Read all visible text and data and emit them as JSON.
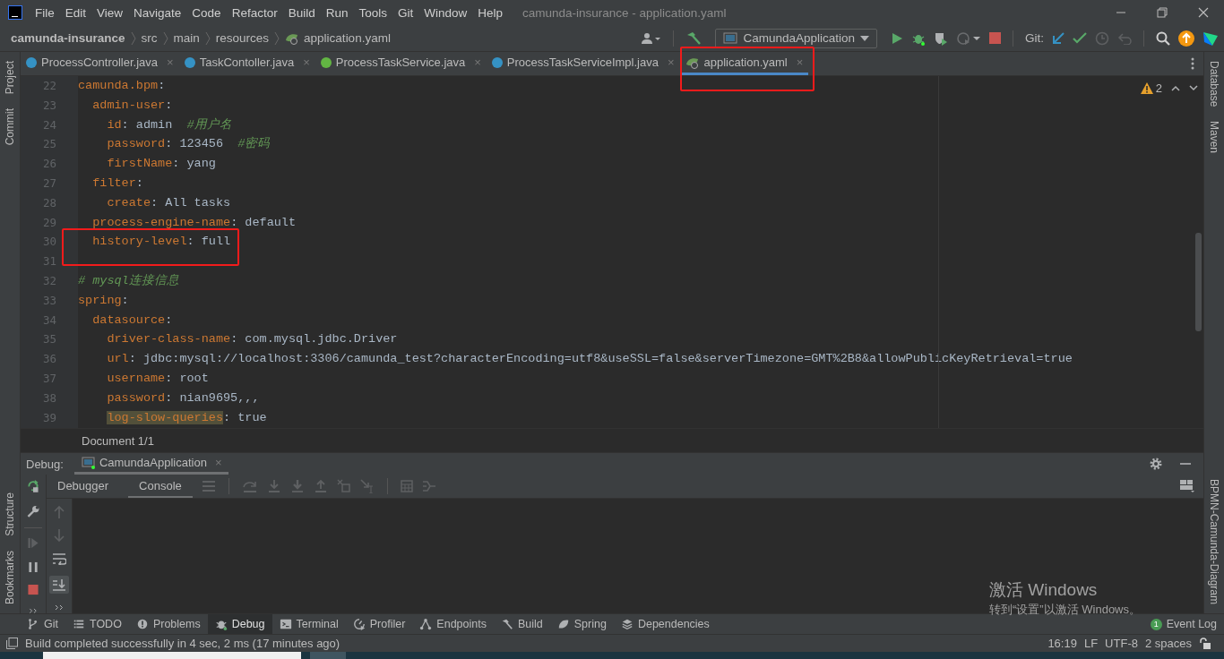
{
  "window": {
    "title": "camunda-insurance - application.yaml"
  },
  "menu": [
    "File",
    "Edit",
    "View",
    "Navigate",
    "Code",
    "Refactor",
    "Build",
    "Run",
    "Tools",
    "Git",
    "Window",
    "Help"
  ],
  "breadcrumbs": [
    {
      "label": "camunda-insurance",
      "kind": "project"
    },
    {
      "label": "src",
      "kind": "folder"
    },
    {
      "label": "main",
      "kind": "folder"
    },
    {
      "label": "resources",
      "kind": "folder"
    },
    {
      "label": "application.yaml",
      "kind": "yaml"
    }
  ],
  "run_config": {
    "label": "CamundaApplication"
  },
  "vcs_label": "Git:",
  "left_panels_top": [
    "Project",
    "Commit"
  ],
  "left_panels_bottom": [
    "Structure",
    "Bookmarks"
  ],
  "right_panels_top": [
    "Database",
    "Maven"
  ],
  "right_panels_bottom": [
    "BPMN-Camunda-Diagram"
  ],
  "tabs": [
    {
      "label": "ProcessController.java",
      "kind": "class",
      "close": "×",
      "selected": false
    },
    {
      "label": "TaskContoller.java",
      "kind": "class",
      "close": "×",
      "selected": false
    },
    {
      "label": "ProcessTaskService.java",
      "kind": "interface",
      "close": "×",
      "selected": false
    },
    {
      "label": "ProcessTaskServiceImpl.java",
      "kind": "class",
      "close": "×",
      "selected": false
    },
    {
      "label": "application.yaml",
      "kind": "yaml",
      "close": "×",
      "selected": true
    }
  ],
  "editor": {
    "warnings": "2",
    "breadcrumb": "Document 1/1",
    "lines": [
      {
        "number": "22",
        "tokens": [
          {
            "kind": "key",
            "text": "camunda.bpm"
          },
          {
            "kind": "punct",
            "text": ":"
          }
        ],
        "children": [
          {
            "number": "23",
            "tokens": [
              {
                "kind": "key",
                "text": "admin-user"
              },
              {
                "kind": "punct",
                "text": ":"
              }
            ],
            "children": [
              {
                "number": "24",
                "tokens": [
                  {
                    "kind": "key",
                    "text": "id"
                  },
                  {
                    "kind": "punct",
                    "text": ": admin  "
                  },
                  {
                    "kind": "comment",
                    "text": "#用户名"
                  }
                ]
              },
              {
                "number": "25",
                "tokens": [
                  {
                    "kind": "key",
                    "text": "password"
                  },
                  {
                    "kind": "punct",
                    "text": ": 123456  "
                  },
                  {
                    "kind": "comment",
                    "text": "#密码"
                  }
                ]
              },
              {
                "number": "26",
                "tokens": [
                  {
                    "kind": "key",
                    "text": "firstName"
                  },
                  {
                    "kind": "punct",
                    "text": ": yang"
                  }
                ]
              }
            ]
          },
          {
            "number": "27",
            "tokens": [
              {
                "kind": "key",
                "text": "filter"
              },
              {
                "kind": "punct",
                "text": ":"
              }
            ],
            "children": [
              {
                "number": "28",
                "tokens": [
                  {
                    "kind": "key",
                    "text": "create"
                  },
                  {
                    "kind": "punct",
                    "text": ": All tasks"
                  }
                ]
              }
            ]
          },
          {
            "number": "29",
            "tokens": [
              {
                "kind": "key",
                "text": "process-engine-name"
              },
              {
                "kind": "punct",
                "text": ": default"
              }
            ]
          },
          {
            "number": "30",
            "tokens": [
              {
                "kind": "key",
                "text": "history-level"
              },
              {
                "kind": "punct",
                "text": ": full"
              }
            ],
            "annotated": true
          }
        ]
      },
      {
        "number": "31"
      },
      {
        "number": "32",
        "tokens": [
          {
            "kind": "comment",
            "text": "# mysql连接信息"
          }
        ]
      },
      {
        "number": "33",
        "tokens": [
          {
            "kind": "key",
            "text": "spring"
          },
          {
            "kind": "punct",
            "text": ":"
          }
        ],
        "children": [
          {
            "number": "34",
            "tokens": [
              {
                "kind": "key",
                "text": "datasource"
              },
              {
                "kind": "punct",
                "text": ":"
              }
            ],
            "children": [
              {
                "number": "35",
                "tokens": [
                  {
                    "kind": "key",
                    "text": "driver-class-name"
                  },
                  {
                    "kind": "punct",
                    "text": ": com.mysql.jdbc.Driver"
                  }
                ]
              },
              {
                "number": "36",
                "tokens": [
                  {
                    "kind": "key",
                    "text": "url"
                  },
                  {
                    "kind": "punct",
                    "text": ": jdbc:mysql://localhost:3306/camunda_test?characterEncoding=utf8&useSSL=false&serverTimezone=GMT%2B8&allowPublicKeyRetrieval=true"
                  }
                ]
              },
              {
                "number": "37",
                "tokens": [
                  {
                    "kind": "key",
                    "text": "username"
                  },
                  {
                    "kind": "punct",
                    "text": ": root"
                  }
                ]
              },
              {
                "number": "38",
                "tokens": [
                  {
                    "kind": "key",
                    "text": "password"
                  },
                  {
                    "kind": "punct",
                    "text": ": nian9695,,,"
                  }
                ]
              },
              {
                "number": "39",
                "tokens": [
                  {
                    "kind": "key-marked",
                    "text": "log-slow-queries"
                  },
                  {
                    "kind": "punct",
                    "text": ": true"
                  }
                ]
              }
            ]
          }
        ]
      }
    ]
  },
  "debug": {
    "title": "Debug:",
    "session": "CamundaApplication",
    "close": "×",
    "subtabs": [
      {
        "label": "Debugger",
        "selected": false
      },
      {
        "label": "Console",
        "selected": true
      }
    ]
  },
  "tool_windows": [
    {
      "label": "Git",
      "kind": "branch",
      "selected": false
    },
    {
      "label": "TODO",
      "kind": "list",
      "selected": false
    },
    {
      "label": "Problems",
      "kind": "alert",
      "selected": false
    },
    {
      "label": "Debug",
      "kind": "bug",
      "selected": true
    },
    {
      "label": "Terminal",
      "kind": "terminal",
      "selected": false
    },
    {
      "label": "Profiler",
      "kind": "gauge",
      "selected": false
    },
    {
      "label": "Endpoints",
      "kind": "nodes",
      "selected": false
    },
    {
      "label": "Build",
      "kind": "hammer",
      "selected": false
    },
    {
      "label": "Spring",
      "kind": "leaf",
      "selected": false
    },
    {
      "label": "Dependencies",
      "kind": "layers",
      "selected": false
    }
  ],
  "event_log": {
    "label": "Event Log",
    "badge": "1"
  },
  "status": {
    "message": "Build completed successfully in 4 sec, 2 ms (17 minutes ago)",
    "items": [
      "16:19",
      "LF",
      "UTF-8",
      "2 spaces"
    ]
  },
  "activation_notice": {
    "title": "激活 Windows",
    "subtitle": "转到“设置”以激活 Windows。"
  }
}
